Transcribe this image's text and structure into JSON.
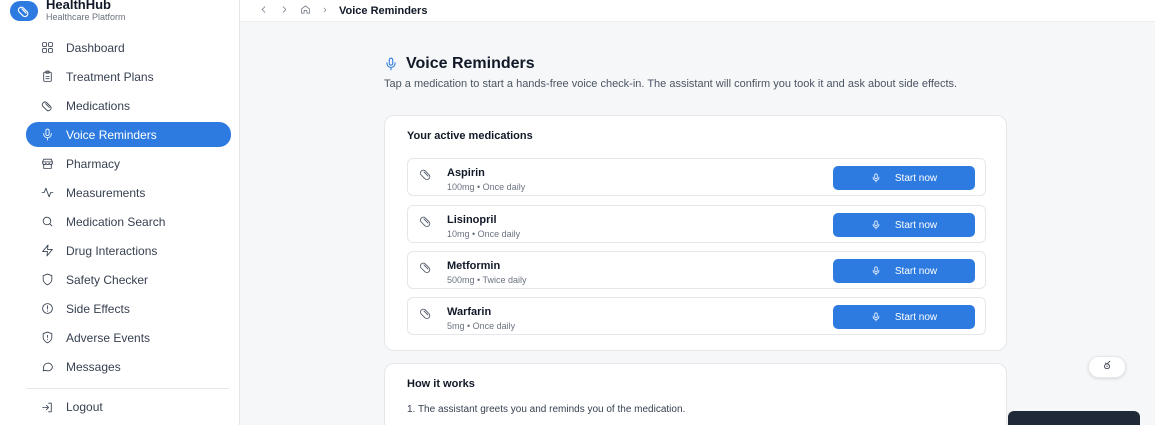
{
  "brand": {
    "name": "HealthHub",
    "subtitle": "Healthcare Platform"
  },
  "sidebar": {
    "items": [
      {
        "label": "Dashboard",
        "icon": "dashboard-icon",
        "active": false
      },
      {
        "label": "Treatment Plans",
        "icon": "clipboard-icon",
        "active": false
      },
      {
        "label": "Medications",
        "icon": "pill-icon",
        "active": false
      },
      {
        "label": "Voice Reminders",
        "icon": "microphone-icon",
        "active": true
      },
      {
        "label": "Pharmacy",
        "icon": "store-icon",
        "active": false
      },
      {
        "label": "Measurements",
        "icon": "activity-icon",
        "active": false
      },
      {
        "label": "Medication Search",
        "icon": "search-icon",
        "active": false
      },
      {
        "label": "Drug Interactions",
        "icon": "zap-icon",
        "active": false
      },
      {
        "label": "Safety Checker",
        "icon": "shield-icon",
        "active": false
      },
      {
        "label": "Side Effects",
        "icon": "alert-circle-icon",
        "active": false
      },
      {
        "label": "Adverse Events",
        "icon": "shield-alert-icon",
        "active": false
      },
      {
        "label": "Messages",
        "icon": "message-icon",
        "active": false
      }
    ],
    "logout_label": "Logout"
  },
  "topbar": {
    "breadcrumb_current": "Voice Reminders"
  },
  "page": {
    "title": "Voice Reminders",
    "description": "Tap a medication to start a hands-free voice check-in. The assistant will confirm you took it and ask about side effects."
  },
  "medications": {
    "title": "Your active medications",
    "button_label": "Start now",
    "items": [
      {
        "name": "Aspirin",
        "dose": "100mg • Once daily"
      },
      {
        "name": "Lisinopril",
        "dose": "10mg • Once daily"
      },
      {
        "name": "Metformin",
        "dose": "500mg • Twice daily"
      },
      {
        "name": "Warfarin",
        "dose": "5mg • Once daily"
      }
    ]
  },
  "how_it_works": {
    "title": "How it works",
    "steps": [
      "1. The assistant greets you and reminds you of the medication."
    ]
  },
  "floating_button": {
    "label": "ఠ"
  },
  "colors": {
    "accent": "#2d7be0",
    "background": "#f6f7f9"
  }
}
